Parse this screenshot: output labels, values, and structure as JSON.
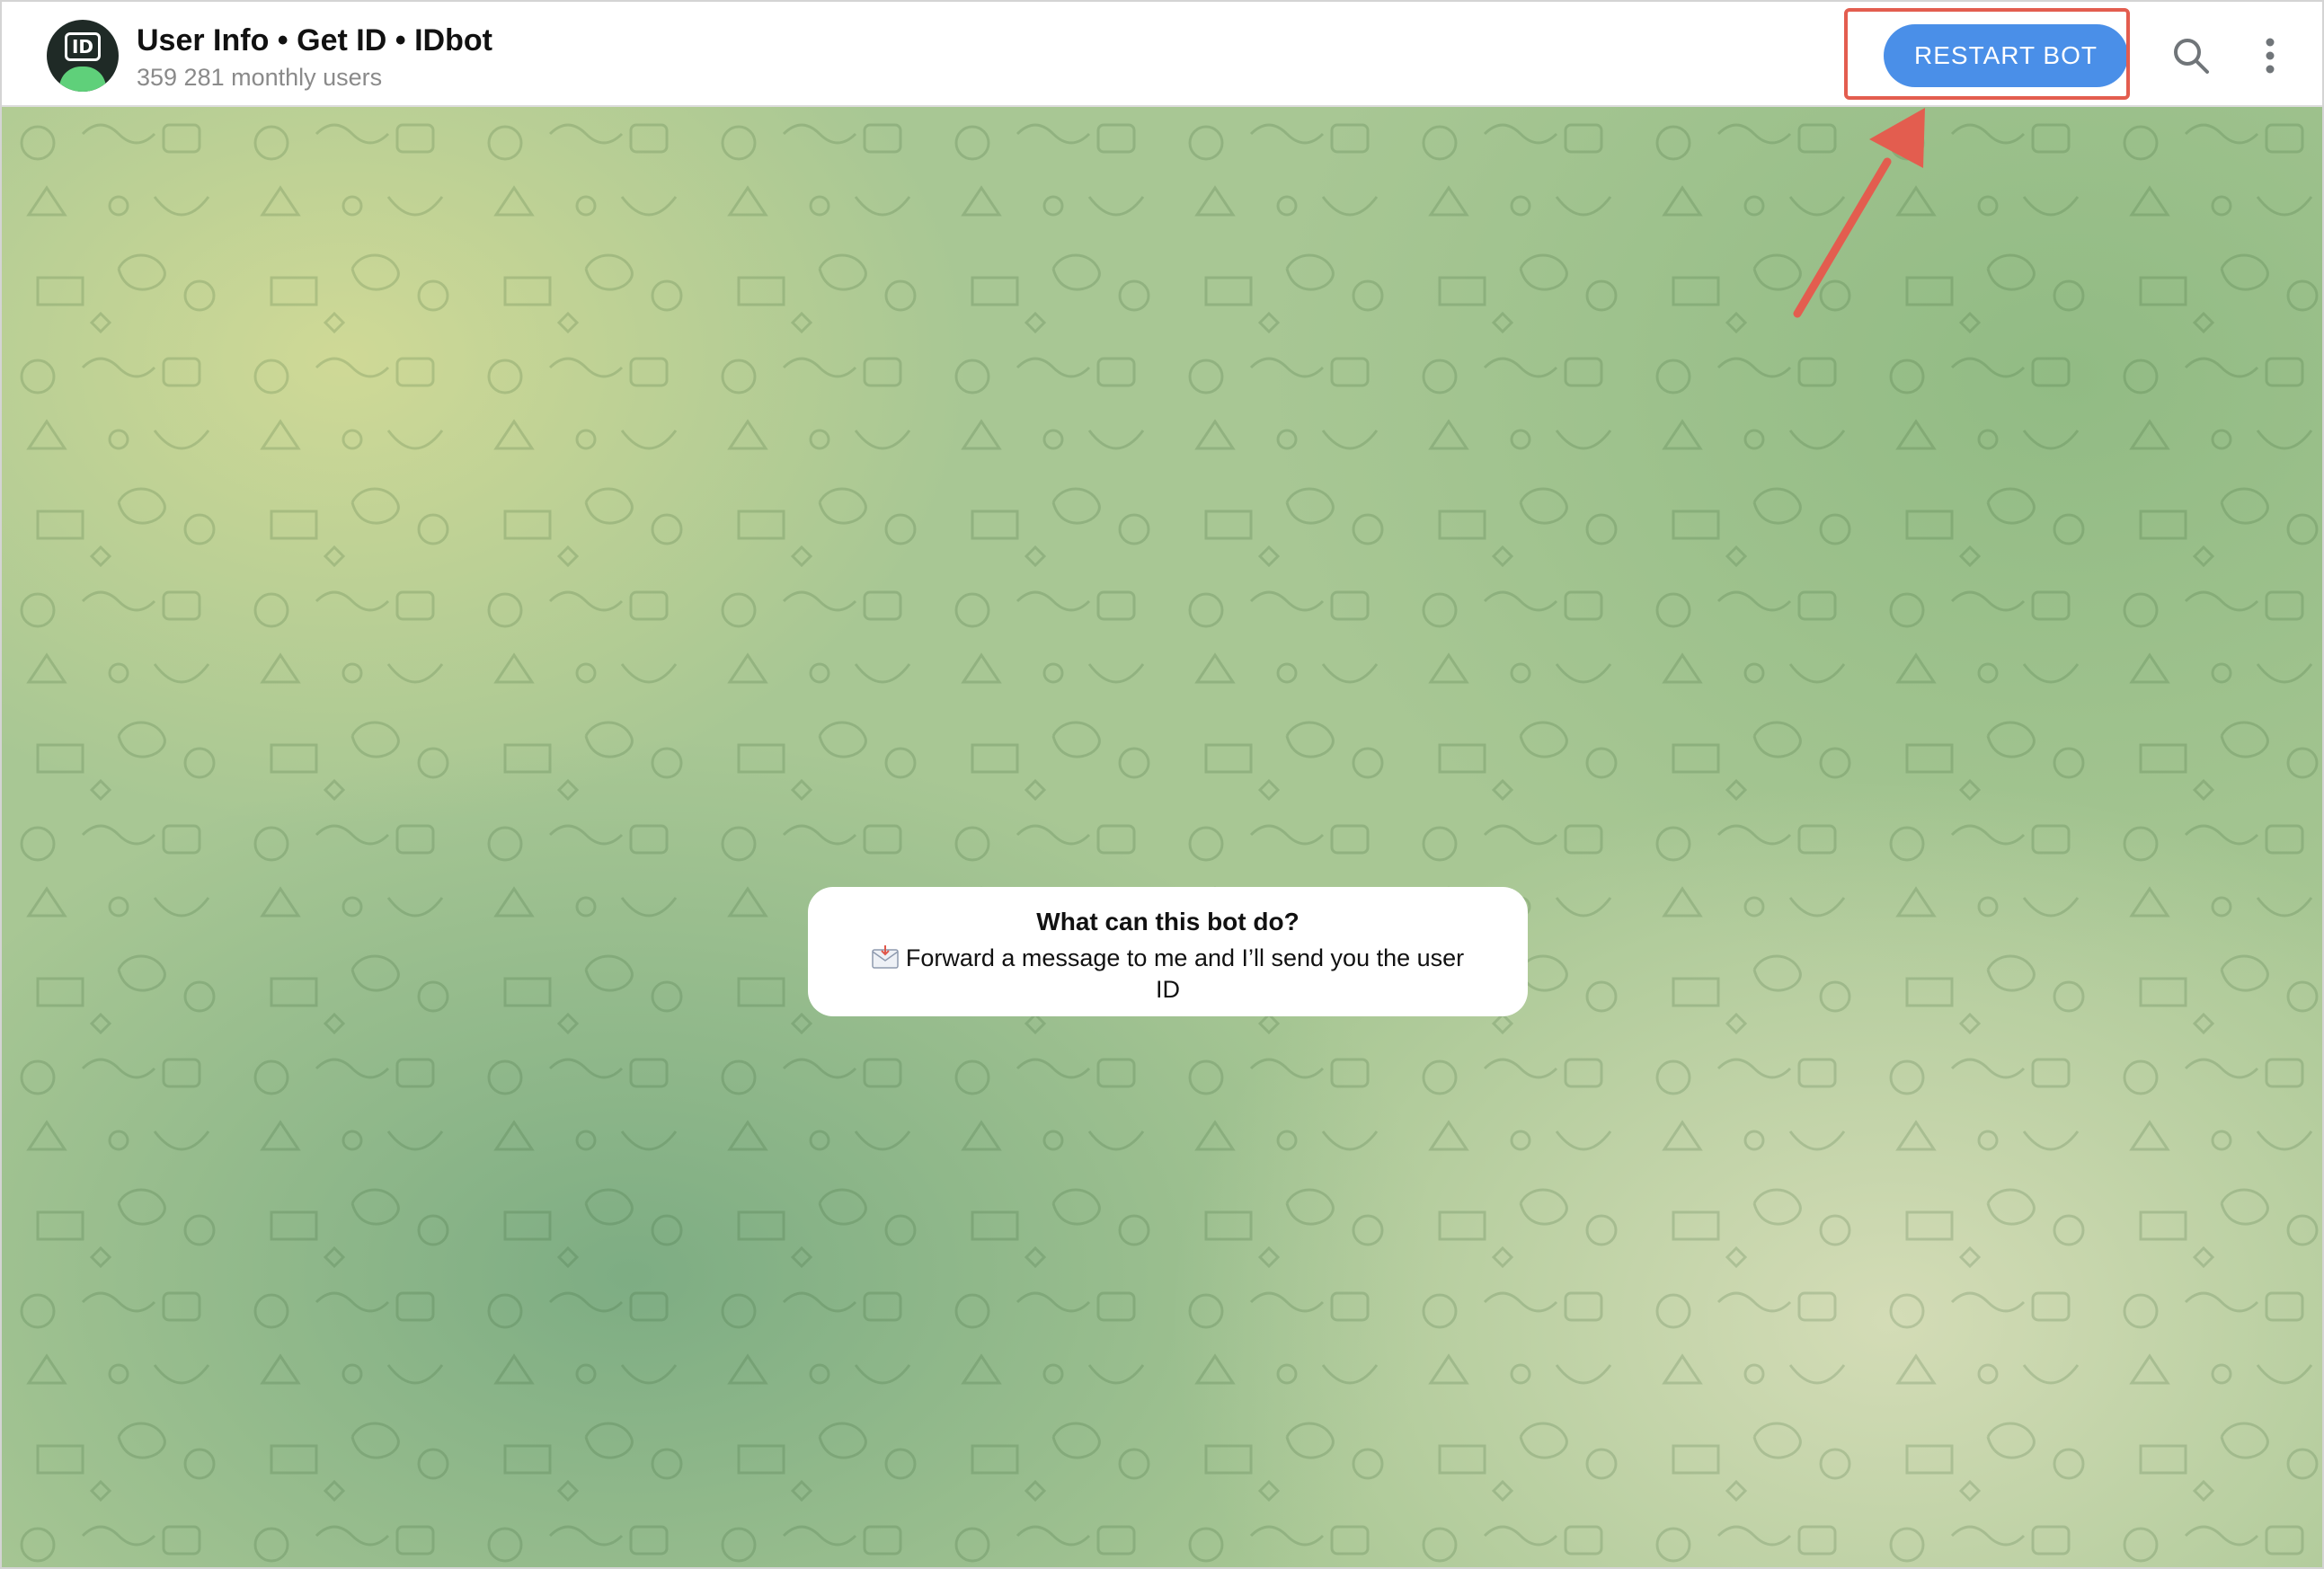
{
  "header": {
    "title": "User Info • Get ID • IDbot",
    "subtitle": "359 281 monthly users",
    "avatar_badge": "ID",
    "restart_label": "RESTART BOT",
    "search_icon": "search-icon",
    "more_icon": "more-vertical-icon"
  },
  "info_card": {
    "title": "What can this bot do?",
    "text": "Forward a message to me and I’ll send you the user ID",
    "icon": "envelope-icon"
  },
  "colors": {
    "accent": "#4a8fe8",
    "highlight": "#e35d4f"
  }
}
